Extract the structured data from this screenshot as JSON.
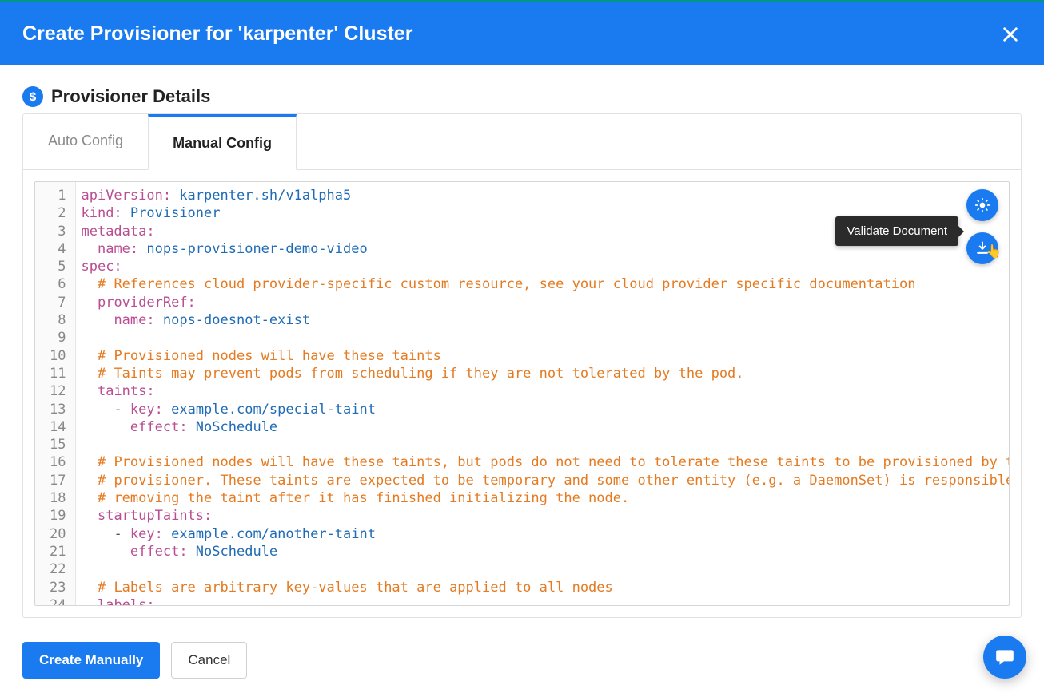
{
  "header": {
    "title": "Create Provisioner for 'karpenter' Cluster"
  },
  "section": {
    "title": "Provisioner Details",
    "icon_text": "$"
  },
  "tabs": {
    "auto": "Auto Config",
    "manual": "Manual Config"
  },
  "tooltip": {
    "validate": "Validate Document"
  },
  "footer": {
    "create": "Create Manually",
    "cancel": "Cancel"
  },
  "code": {
    "line_count": 24,
    "lines": [
      [
        [
          "key",
          "apiVersion:"
        ],
        [
          "str",
          " karpenter.sh/v1alpha5"
        ]
      ],
      [
        [
          "key",
          "kind:"
        ],
        [
          "str",
          " Provisioner"
        ]
      ],
      [
        [
          "key",
          "metadata:"
        ]
      ],
      [
        [
          "plain",
          "  "
        ],
        [
          "key",
          "name:"
        ],
        [
          "str",
          " nops-provisioner-demo-video"
        ]
      ],
      [
        [
          "key",
          "spec:"
        ]
      ],
      [
        [
          "plain",
          "  "
        ],
        [
          "comment",
          "# References cloud provider-specific custom resource, see your cloud provider specific documentation"
        ]
      ],
      [
        [
          "plain",
          "  "
        ],
        [
          "key",
          "providerRef:"
        ]
      ],
      [
        [
          "plain",
          "    "
        ],
        [
          "key",
          "name:"
        ],
        [
          "str",
          " nops-doesnot-exist"
        ]
      ],
      [],
      [
        [
          "plain",
          "  "
        ],
        [
          "comment",
          "# Provisioned nodes will have these taints"
        ]
      ],
      [
        [
          "plain",
          "  "
        ],
        [
          "comment",
          "# Taints may prevent pods from scheduling if they are not tolerated by the pod."
        ]
      ],
      [
        [
          "plain",
          "  "
        ],
        [
          "key",
          "taints:"
        ]
      ],
      [
        [
          "plain",
          "    "
        ],
        [
          "dash",
          "- "
        ],
        [
          "key",
          "key:"
        ],
        [
          "str",
          " example.com/special-taint"
        ]
      ],
      [
        [
          "plain",
          "      "
        ],
        [
          "key",
          "effect:"
        ],
        [
          "str",
          " NoSchedule"
        ]
      ],
      [],
      [
        [
          "plain",
          "  "
        ],
        [
          "comment",
          "# Provisioned nodes will have these taints, but pods do not need to tolerate these taints to be provisioned by this"
        ]
      ],
      [
        [
          "plain",
          "  "
        ],
        [
          "comment",
          "# provisioner. These taints are expected to be temporary and some other entity (e.g. a DaemonSet) is responsible fo"
        ]
      ],
      [
        [
          "plain",
          "  "
        ],
        [
          "comment",
          "# removing the taint after it has finished initializing the node."
        ]
      ],
      [
        [
          "plain",
          "  "
        ],
        [
          "key",
          "startupTaints:"
        ]
      ],
      [
        [
          "plain",
          "    "
        ],
        [
          "dash",
          "- "
        ],
        [
          "key",
          "key:"
        ],
        [
          "str",
          " example.com/another-taint"
        ]
      ],
      [
        [
          "plain",
          "      "
        ],
        [
          "key",
          "effect:"
        ],
        [
          "str",
          " NoSchedule"
        ]
      ],
      [],
      [
        [
          "plain",
          "  "
        ],
        [
          "comment",
          "# Labels are arbitrary key-values that are applied to all nodes"
        ]
      ],
      [
        [
          "plain",
          "  "
        ],
        [
          "key",
          "labels:"
        ]
      ]
    ]
  }
}
